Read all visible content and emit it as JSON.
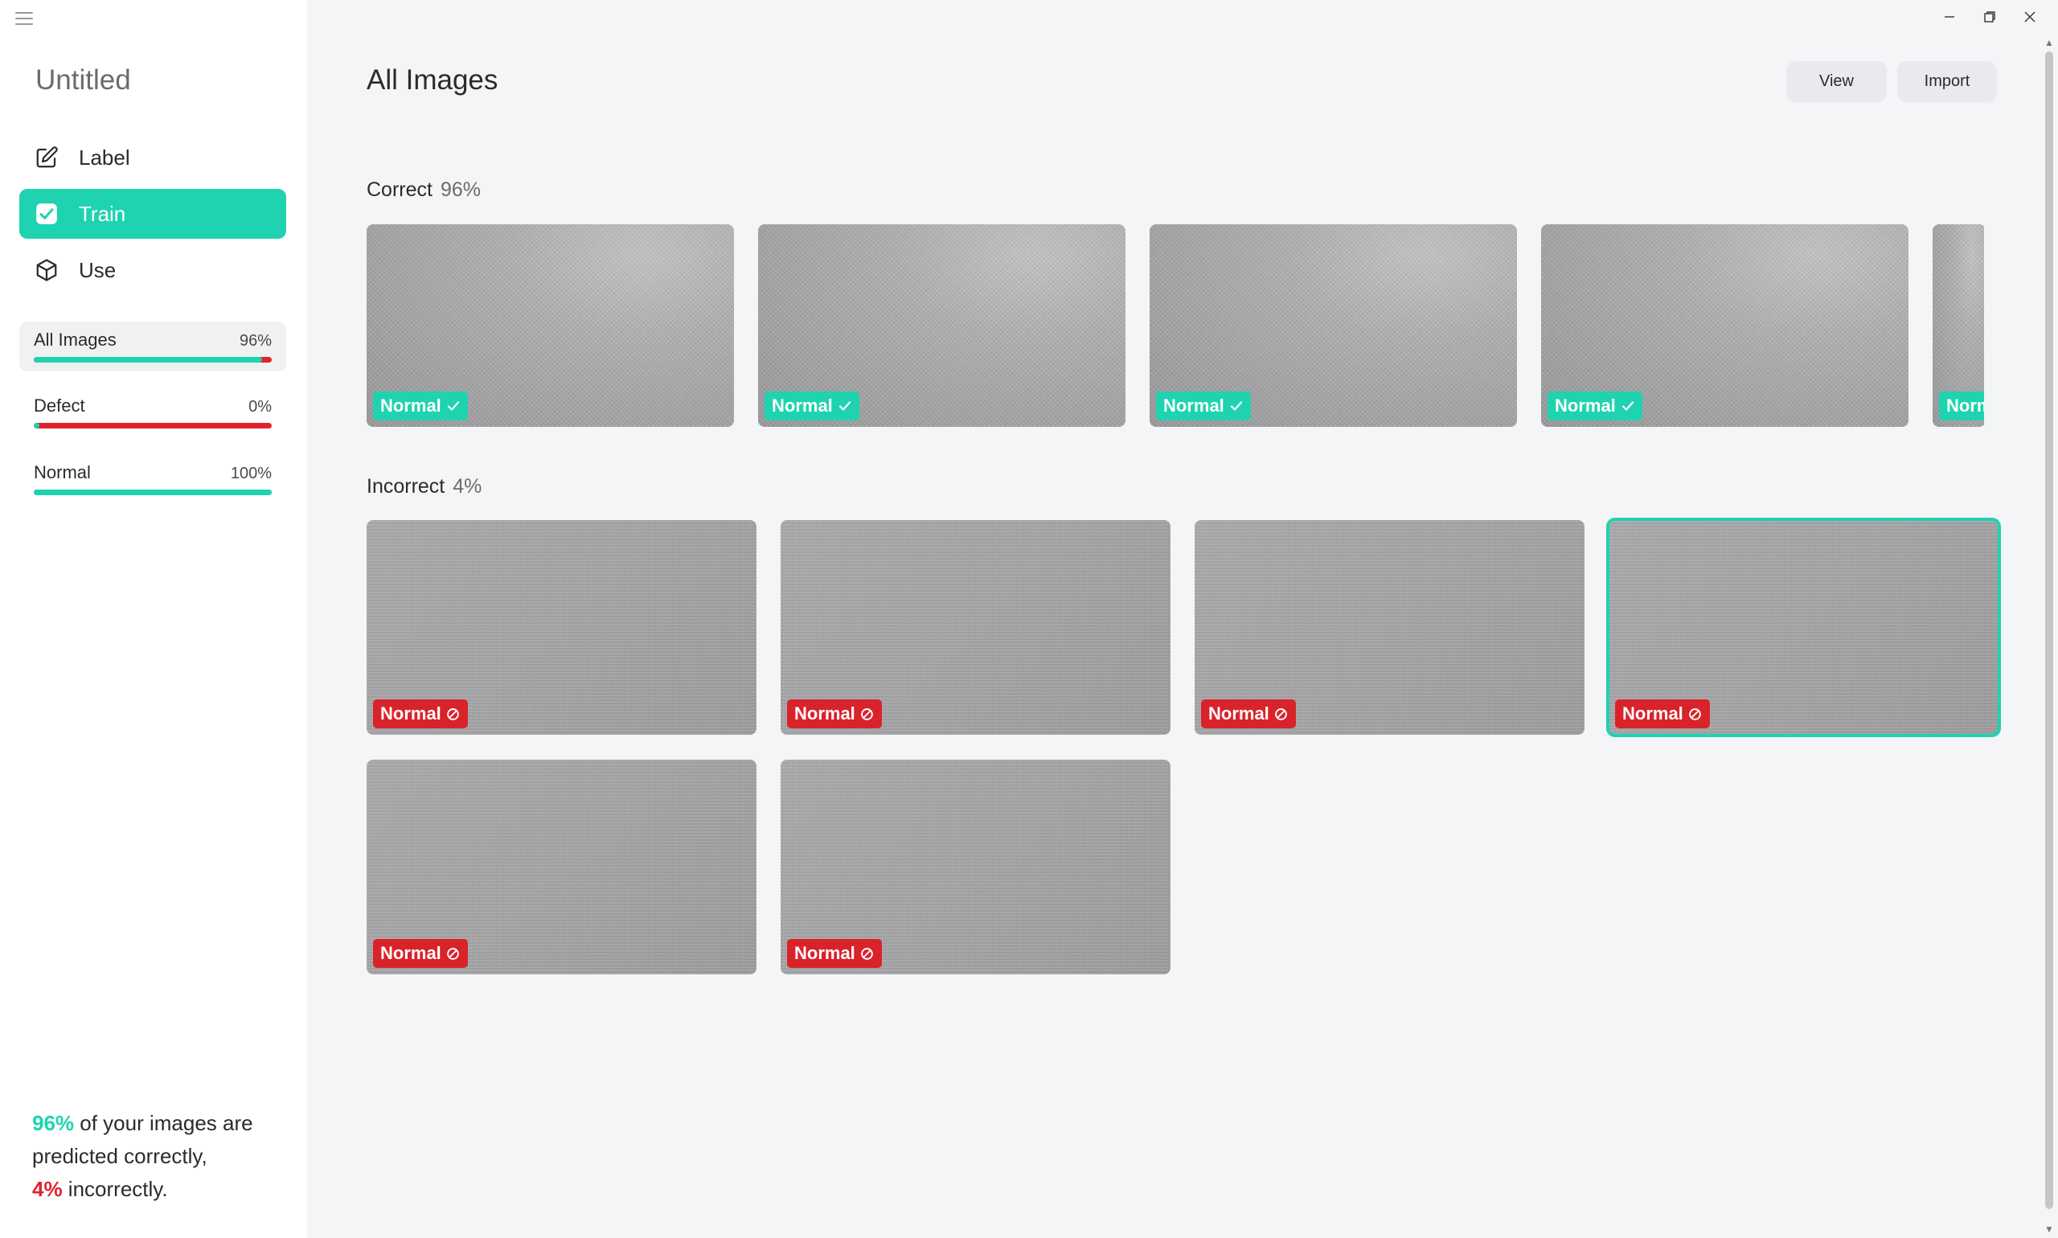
{
  "app": {
    "title": "Untitled"
  },
  "nav": [
    {
      "label": "Label",
      "icon": "edit-icon",
      "active": false
    },
    {
      "label": "Train",
      "icon": "checkbox-icon",
      "active": true
    },
    {
      "label": "Use",
      "icon": "cube-icon",
      "active": false
    }
  ],
  "stats": [
    {
      "name": "All Images",
      "value": "96%",
      "fraction_correct": 0.96,
      "selected": true
    },
    {
      "name": "Defect",
      "value": "0%",
      "fraction_correct": 0.0,
      "selected": false
    },
    {
      "name": "Normal",
      "value": "100%",
      "fraction_correct": 1.0,
      "selected": false
    }
  ],
  "summary": {
    "correct_pct": "96%",
    "line1": " of your images are",
    "line2": "predicted correctly,",
    "incorrect_pct": "4%",
    "line3": " incorrectly."
  },
  "main": {
    "title": "All Images",
    "buttons": {
      "view": "View",
      "import": "Import"
    },
    "sections": {
      "correct": {
        "label": "Correct",
        "pct": "96%"
      },
      "incorrect": {
        "label": "Incorrect",
        "pct": "4%"
      }
    },
    "correct_tiles": [
      {
        "label": "Normal",
        "status": "correct"
      },
      {
        "label": "Normal",
        "status": "correct"
      },
      {
        "label": "Normal",
        "status": "correct"
      },
      {
        "label": "Normal",
        "status": "correct"
      },
      {
        "label": "Normal",
        "status": "correct"
      }
    ],
    "incorrect_tiles": [
      {
        "label": "Normal",
        "status": "incorrect",
        "selected": false
      },
      {
        "label": "Normal",
        "status": "incorrect",
        "selected": false
      },
      {
        "label": "Normal",
        "status": "incorrect",
        "selected": false
      },
      {
        "label": "Normal",
        "status": "incorrect",
        "selected": true
      },
      {
        "label": "Normal",
        "status": "incorrect",
        "selected": false
      },
      {
        "label": "Normal",
        "status": "incorrect",
        "selected": false
      }
    ]
  },
  "colors": {
    "accent": "#1fd3b0",
    "error": "#d9232b"
  }
}
